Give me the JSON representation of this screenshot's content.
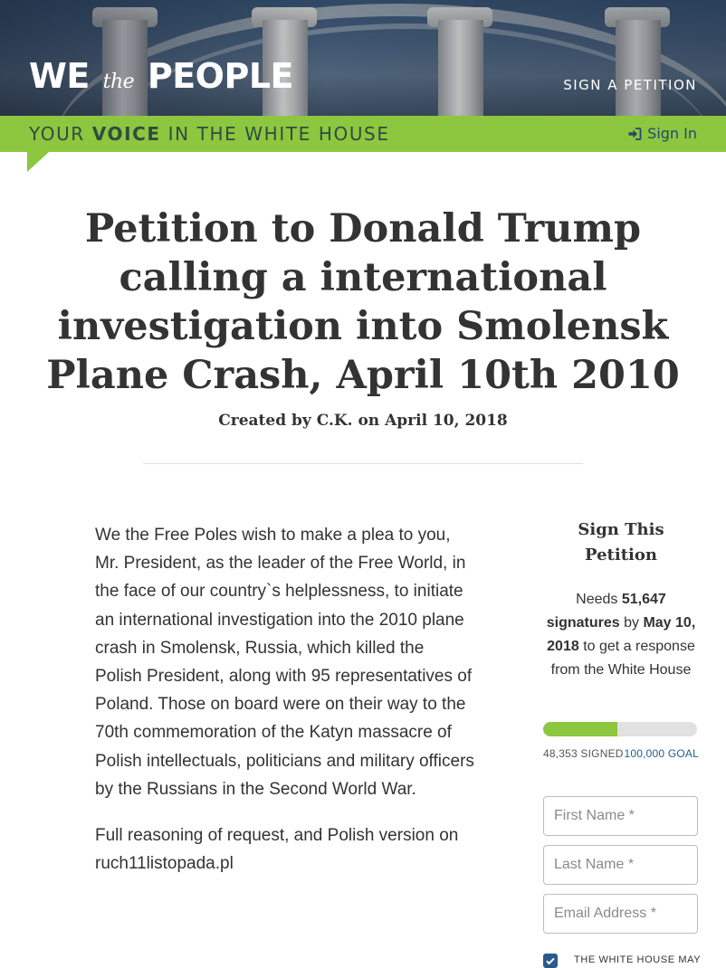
{
  "header": {
    "logo_we": "WE",
    "logo_the": "the",
    "logo_people": "PEOPLE",
    "nav_sign_petition": "SIGN A PETITION"
  },
  "tagline": {
    "part1": "YOUR ",
    "emphasis": "VOICE",
    "part2": " IN THE WHITE HOUSE",
    "signin_label": "Sign In",
    "signin_icon": "sign-in-icon"
  },
  "petition": {
    "title": "Petition to Donald Trump calling a international investigation into Smolensk Plane Crash, April 10th 2010",
    "created": "Created by C.K. on April 10, 2018",
    "paragraphs": [
      "We the Free Poles wish to make a plea to you, Mr. President, as the leader of the Free World, in the face of our country`s helplessness, to initiate an international investigation into the 2010 plane crash in Smolensk, Russia, which killed the Polish President, along with 95 representatives of Poland. Those on board were on their way to the 70th commemoration of the Katyn massacre of Polish intellectuals, politicians and military officers by the Russians in the Second World War.",
      "Full reasoning of request, and Polish version on ruch11listopada.pl"
    ]
  },
  "sign_panel": {
    "heading": "Sign This Petition",
    "needs_prefix": "Needs ",
    "needs_count": "51,647",
    "needs_signatures": "signatures",
    "needs_by": " by ",
    "needs_deadline": "May 10, 2018",
    "needs_suffix": " to get a response from the White House",
    "progress_fraction": 0.48353,
    "signed_label": "48,353 SIGNED",
    "goal_label": "100,000 GOAL",
    "first_name_placeholder": "First Name *",
    "last_name_placeholder": "Last Name *",
    "email_placeholder": "Email Address *",
    "consent_text": "THE WHITE HOUSE MAY",
    "consent_checked": true
  },
  "colors": {
    "accent_green": "#8dc63f",
    "tagline_text": "#2c4e3f",
    "link_blue": "#1f4a73",
    "checkbox_blue": "#2a5a8c"
  }
}
